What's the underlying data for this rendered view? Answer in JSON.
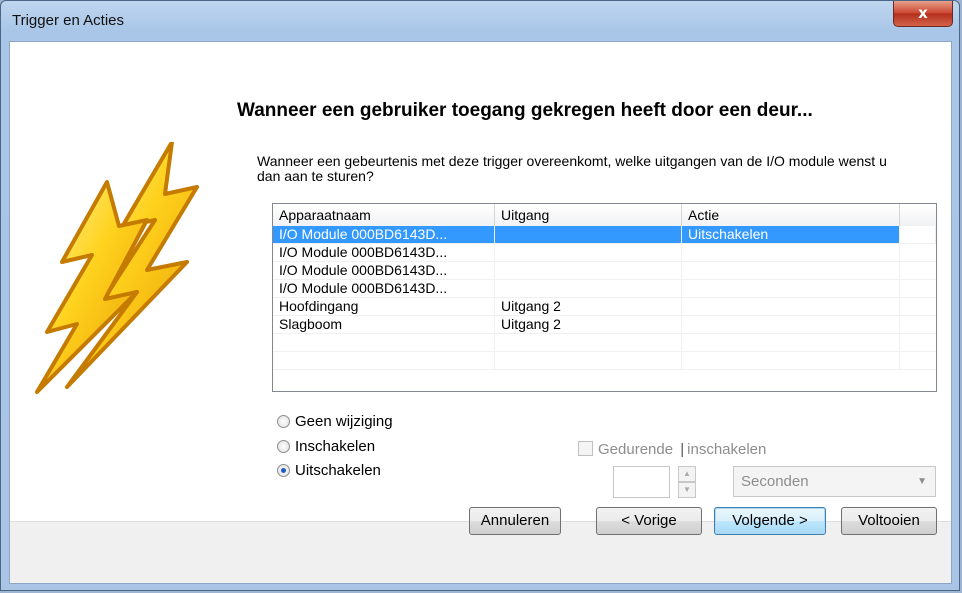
{
  "window": {
    "title": "Trigger en Acties",
    "close_label": "x"
  },
  "main": {
    "heading": "Wanneer een gebruiker toegang gekregen heeft door een deur...",
    "description": "Wanneer een gebeurtenis met deze trigger overeenkomt, welke uitgangen van de I/O module wenst u dan aan te sturen?"
  },
  "table": {
    "columns": [
      "Apparaatnaam",
      "Uitgang",
      "Actie"
    ],
    "rows": [
      {
        "name": "I/O Module 000BD6143D...",
        "output": "",
        "action": "Uitschakelen",
        "selected": true
      },
      {
        "name": "I/O Module 000BD6143D...",
        "output": "",
        "action": ""
      },
      {
        "name": "I/O Module 000BD6143D...",
        "output": "",
        "action": ""
      },
      {
        "name": "I/O Module 000BD6143D...",
        "output": "",
        "action": ""
      },
      {
        "name": "Hoofdingang",
        "output": "Uitgang 2",
        "action": ""
      },
      {
        "name": "Slagboom",
        "output": "Uitgang 2",
        "action": ""
      }
    ]
  },
  "options": {
    "radios": [
      {
        "label": "Geen wijziging",
        "checked": false
      },
      {
        "label": "Inschakelen",
        "checked": false
      },
      {
        "label": "Uitschakelen",
        "checked": true
      }
    ],
    "duration_checkbox_label": "Gedurende",
    "duration_suffix": "inschakelen",
    "duration_value": "",
    "unit_selected": "Seconden"
  },
  "buttons": {
    "cancel": "Annuleren",
    "previous": "< Vorige",
    "next": "Volgende >",
    "finish": "Voltooien"
  },
  "colors": {
    "selection": "#3399ff",
    "bolt_fill": "#ffd21e",
    "bolt_edge": "#c57a00"
  },
  "icons": {
    "art": "lightning-bolts-icon"
  }
}
